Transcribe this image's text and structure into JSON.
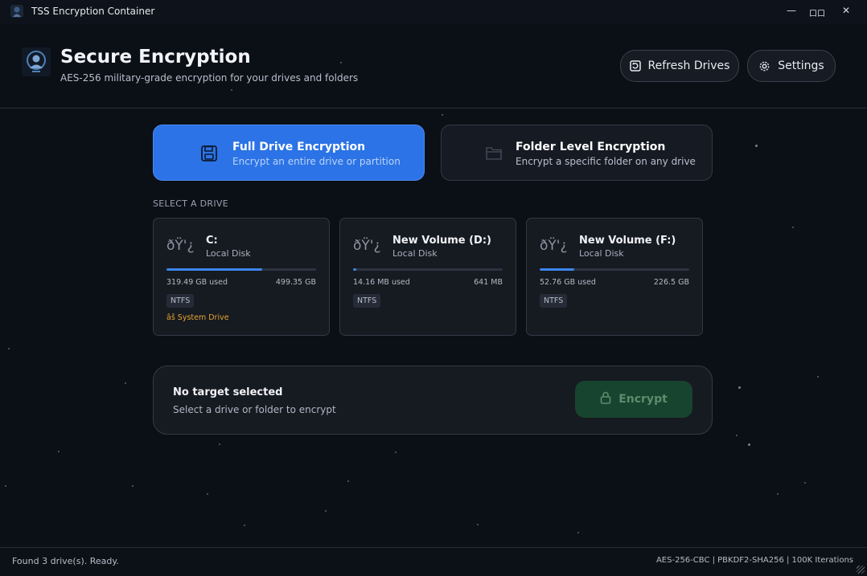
{
  "window": {
    "title": "TSS Encryption Container",
    "controls": {
      "minimize": "—",
      "maximize": "口口",
      "close": "✕"
    }
  },
  "header": {
    "title": "Secure Encryption",
    "subtitle": "AES-256 military-grade encryption for your drives and folders",
    "refresh_label": "Refresh Drives",
    "settings_label": "Settings"
  },
  "modes": [
    {
      "title": "Full Drive Encryption",
      "subtitle": "Encrypt an entire drive or partition",
      "active": true,
      "icon": "floppy-disk-icon"
    },
    {
      "title": "Folder Level Encryption",
      "subtitle": "Encrypt a specific folder on any drive",
      "active": false,
      "icon": "folder-icon"
    }
  ],
  "drives_section_label": "SELECT A DRIVE",
  "drives": [
    {
      "icon_text": "ðŸ'¿",
      "name": "C:",
      "type": "Local Disk",
      "used": "319.49 GB used",
      "total": "499.35 GB",
      "fill_fraction": 0.64,
      "fs": "NTFS",
      "system": "âš  System Drive"
    },
    {
      "icon_text": "ðŸ'¿",
      "name": "New Volume (D:)",
      "type": "Local Disk",
      "used": "14.16 MB used",
      "total": "641 MB",
      "fill_fraction": 0.022,
      "fs": "NTFS",
      "system": ""
    },
    {
      "icon_text": "ðŸ'¿",
      "name": "New Volume (F:)",
      "type": "Local Disk",
      "used": "52.76 GB used",
      "total": "226.5 GB",
      "fill_fraction": 0.233,
      "fs": "NTFS",
      "system": ""
    }
  ],
  "action": {
    "title": "No target selected",
    "subtitle": "Select a drive or folder to encrypt",
    "encrypt_label": "Encrypt"
  },
  "status": {
    "left": "Found 3 drive(s). Ready.",
    "right": "AES-256-CBC  |  PBKDF2-SHA256  |  100K Iterations"
  },
  "colors": {
    "accent": "#2b73e6",
    "progress": "#3d86ee",
    "encrypt_button": "#17442e",
    "warning": "#e5a530"
  }
}
